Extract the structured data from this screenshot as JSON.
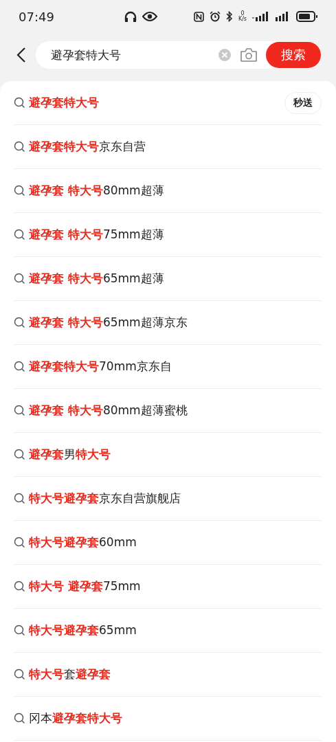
{
  "status_bar": {
    "time": "07:49",
    "net_speed_value": "0",
    "net_speed_unit": "K/s"
  },
  "search": {
    "value": "避孕套特大号",
    "button": "搜索"
  },
  "suggestions": [
    {
      "text": "**避孕套特大号**",
      "tag": "秒送"
    },
    {
      "text": "**避孕套特大号**京东自营"
    },
    {
      "text": "**避孕套 特大号**80mm超薄"
    },
    {
      "text": "**避孕套 特大号**75mm超薄"
    },
    {
      "text": "**避孕套 特大号**65mm超薄"
    },
    {
      "text": "**避孕套 特大号**65mm超薄京东"
    },
    {
      "text": "**避孕套特大号**70mm京东自"
    },
    {
      "text": "**避孕套 特大号**80mm超薄蜜桃"
    },
    {
      "text": "**避孕套**男**特大号**"
    },
    {
      "text": "**特大号避孕套**京东自营旗舰店"
    },
    {
      "text": "**特大号避孕套**60mm"
    },
    {
      "text": "**特大号 避孕套**75mm"
    },
    {
      "text": "**特大号避孕套**65mm"
    },
    {
      "text": "**特大号**套**避孕套**"
    },
    {
      "text": "冈本**避孕套特大号**"
    }
  ]
}
